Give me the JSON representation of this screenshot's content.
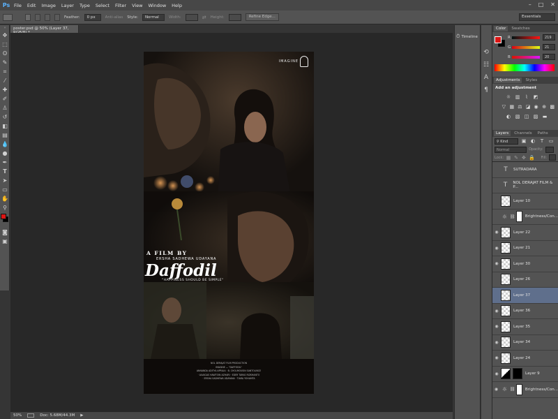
{
  "app": {
    "logo": "Ps"
  },
  "menu": [
    "File",
    "Edit",
    "Image",
    "Layer",
    "Type",
    "Select",
    "Filter",
    "View",
    "Window",
    "Help"
  ],
  "window_controls": [
    "–",
    "□",
    "✕"
  ],
  "options": {
    "feather_label": "Feather:",
    "feather_value": "0 px",
    "anti_alias": "Anti-alias",
    "style_label": "Style:",
    "style_value": "Normal",
    "width_label": "Width:",
    "height_label": "Height:",
    "refine_edge": "Refine Edge...",
    "workspace": "Essentials"
  },
  "document": {
    "tab_title": "poster.psd @ 50% (Layer 37, RGB/8) *",
    "zoom": "50%",
    "doc_size": "Doc: 5.68M/44.3M"
  },
  "poster": {
    "logo_text": "IMAGINE",
    "a_film_by": "A FILM BY",
    "director": "ERSHA SADHEWA UDAYANA",
    "title": "Daffodil",
    "tagline": "\"HAPPINESS SHOULD BE SIMPLE\"",
    "credits_header": "NOL DERAJAT FILM PRODUCTION",
    "credits_line1": "IMAGINE  —  \"DAFFODIL\"",
    "credits_line2": "ANNANDA ADITYA APRILIA  ·  B. CHOLMOUSIN SANTOLINCE",
    "credits_line3": "· ALVAGAS HAWTOIN AZHARI  · EDER TARAS RIZKHANTO",
    "credits_line4": "· ERSHA SADHEWA UDAYANA  ·  TIARA YOHAMTA"
  },
  "strip": {
    "timeline_label": "Timeline"
  },
  "color_panel": {
    "tabs": [
      "Color",
      "Swatches"
    ],
    "r_label": "R",
    "r_value": "219",
    "g_label": "G",
    "g_value": "21",
    "b_label": "B",
    "b_value": "20",
    "foreground_color": "#db1514"
  },
  "adjustments_panel": {
    "tabs": [
      "Adjustments",
      "Styles"
    ],
    "heading": "Add an adjustment"
  },
  "layers_panel": {
    "tabs": [
      "Layers",
      "Channels",
      "Paths"
    ],
    "kind": "Kind",
    "blend_mode": "Normal",
    "opacity_label": "Opacity:",
    "lock_label": "Lock:",
    "fill_label": "Fill:",
    "layers": [
      {
        "name": "SUTRADARA",
        "type": "text",
        "visible": false
      },
      {
        "name": "NOL DERAJAT FILM & P...",
        "type": "text",
        "visible": false
      },
      {
        "name": "Layer 10",
        "type": "pixel",
        "visible": false
      },
      {
        "name": "Brightness/Con...",
        "type": "adjustment",
        "visible": false
      },
      {
        "name": "Layer 22",
        "type": "pixel",
        "visible": true
      },
      {
        "name": "Layer 21",
        "type": "pixel",
        "visible": true
      },
      {
        "name": "Layer 30",
        "type": "pixel",
        "visible": true
      },
      {
        "name": "Layer 26",
        "type": "pixel",
        "visible": false
      },
      {
        "name": "Layer 37",
        "type": "pixel",
        "visible": false,
        "selected": true
      },
      {
        "name": "Layer 36",
        "type": "pixel",
        "visible": true
      },
      {
        "name": "Layer 35",
        "type": "pixel",
        "visible": true
      },
      {
        "name": "Layer 34",
        "type": "pixel",
        "visible": true
      },
      {
        "name": "Layer 24",
        "type": "pixel",
        "visible": true
      },
      {
        "name": "Layer 9",
        "type": "pixel",
        "visible": true
      },
      {
        "name": "Brightness/Con...",
        "type": "adjustment",
        "visible": true
      }
    ]
  }
}
